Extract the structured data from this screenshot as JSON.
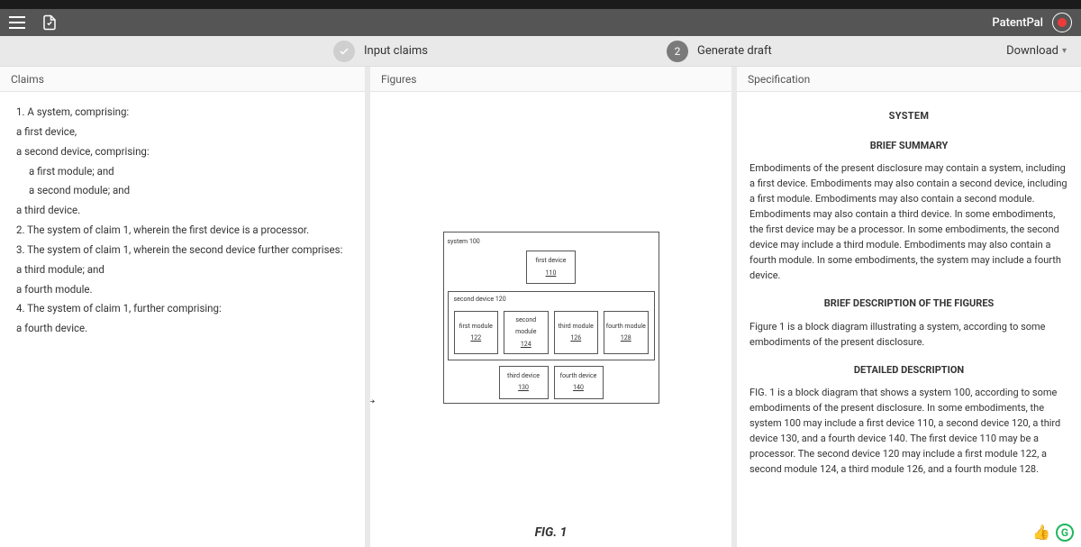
{
  "browser": {
    "url": "draftpatentpal.com"
  },
  "app": {
    "brand": "PatentPal"
  },
  "stepper": {
    "step1_label": "Input claims",
    "step2_num": "2",
    "step2_label": "Generate draft",
    "download_label": "Download"
  },
  "panels": {
    "claims_header": "Claims",
    "figures_header": "Figures",
    "spec_header": "Specification"
  },
  "claims": {
    "l1": "1. A system, comprising:",
    "l2": "a first device,",
    "l3": "a second device, comprising:",
    "l4": "a first module; and",
    "l5": "a second module; and",
    "l6": "a third device.",
    "l7": "2. The system of claim 1, wherein the first device is a processor.",
    "l8": "3. The system of claim 1, wherein the second device further comprises:",
    "l9": "a third module; and",
    "l10": "a fourth module.",
    "l11": "4. The system of claim 1, further comprising:",
    "l12": "a fourth device."
  },
  "figure": {
    "system_label": "system",
    "system_num": "100",
    "first_device_label": "first device",
    "first_device_num": "110",
    "second_device_label": "second device",
    "second_device_num": "120",
    "m1_label": "first module",
    "m1_num": "122",
    "m2_label": "second module",
    "m2_num": "124",
    "m3_label": "third module",
    "m3_num": "126",
    "m4_label": "fourth module",
    "m4_num": "128",
    "third_device_label": "third device",
    "third_device_num": "130",
    "fourth_device_label": "fourth device",
    "fourth_device_num": "140",
    "caption": "FIG. 1"
  },
  "spec": {
    "title": "SYSTEM",
    "s1": "BRIEF SUMMARY",
    "p1": "Embodiments of the present disclosure may contain a system, including a first device. Embodiments may also contain a second device, including a first module. Embodiments may also contain a second module. Embodiments may also contain a third device. In some embodiments, the first device may be a processor. In some embodiments, the second device may include a third module. Embodiments may also contain a fourth module. In some embodiments, the system may include a fourth device.",
    "s2": "BRIEF DESCRIPTION OF THE FIGURES",
    "p2": "Figure 1 is a block diagram illustrating a system, according to some embodiments of the present disclosure.",
    "s3": "DETAILED DESCRIPTION",
    "p3": "FIG. 1 is a block diagram that shows a system 100, according to some embodiments of the present disclosure. In some embodiments, the system 100 may include a first device 110, a second device 120, a third device 130, and a fourth device 140. The first device 110 may be a processor. The second device 120 may include a first module 122, a second module 124, a third module 126, and a fourth module 128."
  }
}
